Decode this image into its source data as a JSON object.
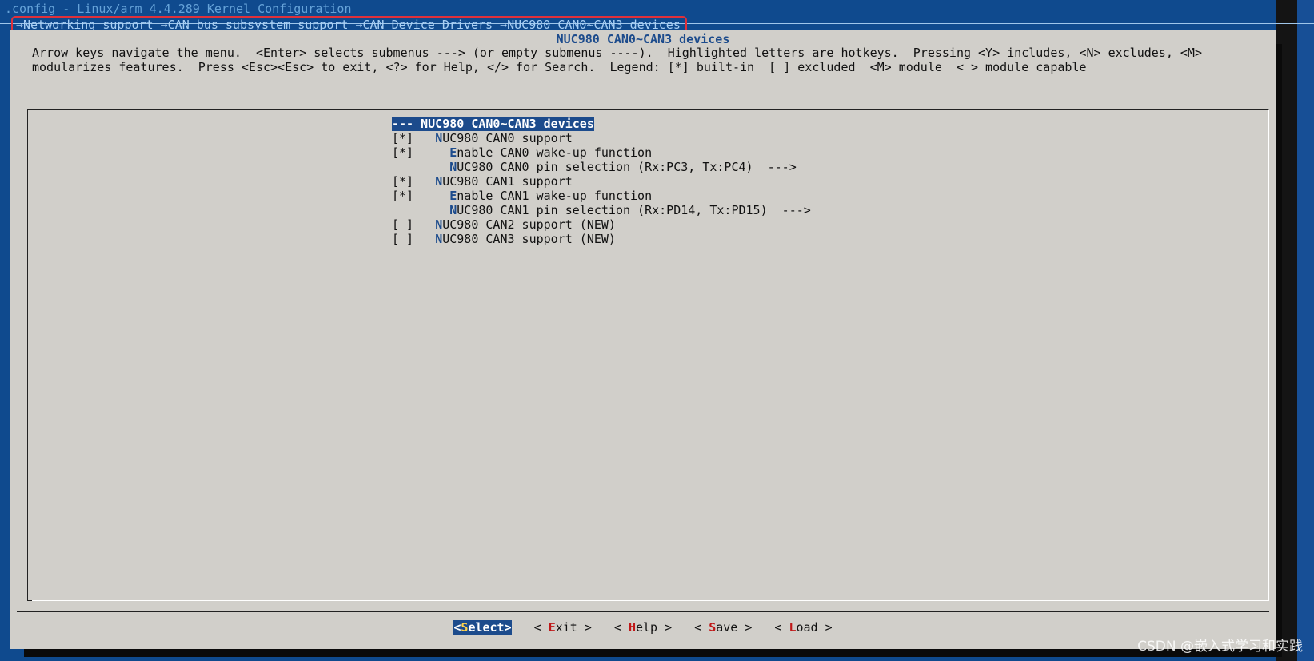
{
  "window": {
    "title": ".config - Linux/arm 4.4.289 Kernel Configuration"
  },
  "breadcrumb": {
    "items": [
      "Networking support",
      "CAN bus subsystem support",
      "CAN Device Drivers",
      "NUC980 CAN0~CAN3 devices"
    ],
    "separator": "→",
    "highlight_color": "#e0303a"
  },
  "dialog": {
    "title": "NUC980 CAN0~CAN3 devices",
    "help_line1": "Arrow keys navigate the menu.  <Enter> selects submenus ---> (or empty submenus ----).  Highlighted letters are hotkeys.  Pressing <Y> includes, <N> excludes, <M>",
    "help_line2": "modularizes features.  Press <Esc><Esc> to exit, <?> for Help, </> for Search.  Legend: [*] built-in  [ ] excluded  <M> module  < > module capable"
  },
  "menu": {
    "items": [
      {
        "state": "---",
        "indent": "",
        "hotkey": "",
        "label": " NUC980 CAN0~CAN3 devices",
        "suffix": "",
        "selected": true
      },
      {
        "state": "[*]",
        "indent": "   ",
        "hotkey": "N",
        "label": "UC980 CAN0 support",
        "suffix": ""
      },
      {
        "state": "[*]",
        "indent": "     ",
        "hotkey": "E",
        "label": "nable CAN0 wake-up function",
        "suffix": ""
      },
      {
        "state": "   ",
        "indent": "     ",
        "hotkey": "N",
        "label": "UC980 CAN0 pin selection (Rx:PC3, Tx:PC4)",
        "suffix": "  --->"
      },
      {
        "state": "[*]",
        "indent": "   ",
        "hotkey": "N",
        "label": "UC980 CAN1 support",
        "suffix": ""
      },
      {
        "state": "[*]",
        "indent": "     ",
        "hotkey": "E",
        "label": "nable CAN1 wake-up function",
        "suffix": ""
      },
      {
        "state": "   ",
        "indent": "     ",
        "hotkey": "N",
        "label": "UC980 CAN1 pin selection (Rx:PD14, Tx:PD15)",
        "suffix": "  --->"
      },
      {
        "state": "[ ]",
        "indent": "   ",
        "hotkey": "N",
        "label": "UC980 CAN2 support (NEW)",
        "suffix": ""
      },
      {
        "state": "[ ]",
        "indent": "   ",
        "hotkey": "N",
        "label": "UC980 CAN3 support (NEW)",
        "suffix": ""
      }
    ]
  },
  "buttons": [
    {
      "left": "<",
      "hotkey": "S",
      "rest": "elect",
      "right": ">",
      "selected": true
    },
    {
      "left": "< ",
      "hotkey": "E",
      "rest": "xit",
      "right": " >",
      "selected": false
    },
    {
      "left": "< ",
      "hotkey": "H",
      "rest": "elp",
      "right": " >",
      "selected": false
    },
    {
      "left": "< ",
      "hotkey": "S",
      "rest": "ave",
      "right": " >",
      "selected": false
    },
    {
      "left": "< ",
      "hotkey": "L",
      "rest": "oad",
      "right": " >",
      "selected": false
    }
  ],
  "watermark": "CSDN @嵌入式学习和实践",
  "colors": {
    "background": "#0f4a8e",
    "dialog": "#d1cfca",
    "accent": "#1c4b8c",
    "hotkey_button": "#c01818"
  }
}
